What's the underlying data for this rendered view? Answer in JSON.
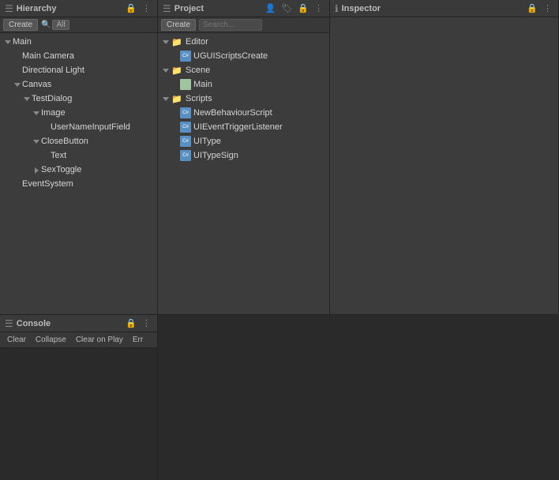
{
  "hierarchy": {
    "title": "Hierarchy",
    "create_label": "Create",
    "search_placeholder": "All",
    "items": [
      {
        "id": "main",
        "label": "Main",
        "indent": 0,
        "arrow": "down",
        "has_icon": false,
        "icon_type": "none"
      },
      {
        "id": "main-camera",
        "label": "Main Camera",
        "indent": 1,
        "arrow": "",
        "has_icon": false,
        "icon_type": "none"
      },
      {
        "id": "directional-light",
        "label": "Directional Light",
        "indent": 1,
        "arrow": "",
        "has_icon": false,
        "icon_type": "none"
      },
      {
        "id": "canvas",
        "label": "Canvas",
        "indent": 1,
        "arrow": "down",
        "has_icon": false,
        "icon_type": "none"
      },
      {
        "id": "testdialog",
        "label": "TestDialog",
        "indent": 2,
        "arrow": "down",
        "has_icon": false,
        "icon_type": "none"
      },
      {
        "id": "image",
        "label": "Image",
        "indent": 3,
        "arrow": "down",
        "has_icon": false,
        "icon_type": "none"
      },
      {
        "id": "usernameinputfield",
        "label": "UserNameInputField",
        "indent": 4,
        "arrow": "",
        "has_icon": false,
        "icon_type": "none"
      },
      {
        "id": "closebutton",
        "label": "CloseButton",
        "indent": 3,
        "arrow": "down",
        "has_icon": false,
        "icon_type": "none"
      },
      {
        "id": "text",
        "label": "Text",
        "indent": 4,
        "arrow": "",
        "has_icon": false,
        "icon_type": "none"
      },
      {
        "id": "sextoggle",
        "label": "SexToggle",
        "indent": 3,
        "arrow": "right",
        "has_icon": false,
        "icon_type": "none"
      },
      {
        "id": "eventsystem",
        "label": "EventSystem",
        "indent": 1,
        "arrow": "",
        "has_icon": false,
        "icon_type": "none"
      }
    ]
  },
  "project": {
    "title": "Project",
    "create_label": "Create",
    "items": [
      {
        "id": "editor",
        "label": "Editor",
        "indent": 0,
        "type": "folder",
        "arrow": "down"
      },
      {
        "id": "uiguiscreate",
        "label": "UGUIScriptsCreate",
        "indent": 1,
        "type": "script",
        "arrow": ""
      },
      {
        "id": "scene",
        "label": "Scene",
        "indent": 0,
        "type": "folder",
        "arrow": "down"
      },
      {
        "id": "main-scene",
        "label": "Main",
        "indent": 1,
        "type": "scene",
        "arrow": ""
      },
      {
        "id": "scripts",
        "label": "Scripts",
        "indent": 0,
        "type": "folder",
        "arrow": "down"
      },
      {
        "id": "newbehaviourscript",
        "label": "NewBehaviourScript",
        "indent": 1,
        "type": "script",
        "arrow": ""
      },
      {
        "id": "uieventtriggerlistener",
        "label": "UIEventTriggerListener",
        "indent": 1,
        "type": "script",
        "arrow": ""
      },
      {
        "id": "uitype",
        "label": "UIType",
        "indent": 1,
        "type": "script",
        "arrow": ""
      },
      {
        "id": "uitypesign",
        "label": "UITypeSign",
        "indent": 1,
        "type": "script",
        "arrow": ""
      }
    ]
  },
  "inspector": {
    "title": "Inspector"
  },
  "console": {
    "title": "Console",
    "buttons": [
      {
        "id": "clear",
        "label": "Clear"
      },
      {
        "id": "collapse",
        "label": "Collapse"
      },
      {
        "id": "clear-on-play",
        "label": "Clear on Play"
      },
      {
        "id": "error",
        "label": "Err"
      }
    ]
  },
  "icons": {
    "hamburger": "☰",
    "dots": "⋮",
    "search": "🔍",
    "folder_open": "📂",
    "script_color": "#5a8fc4",
    "scene_color": "#a0c4a0"
  }
}
